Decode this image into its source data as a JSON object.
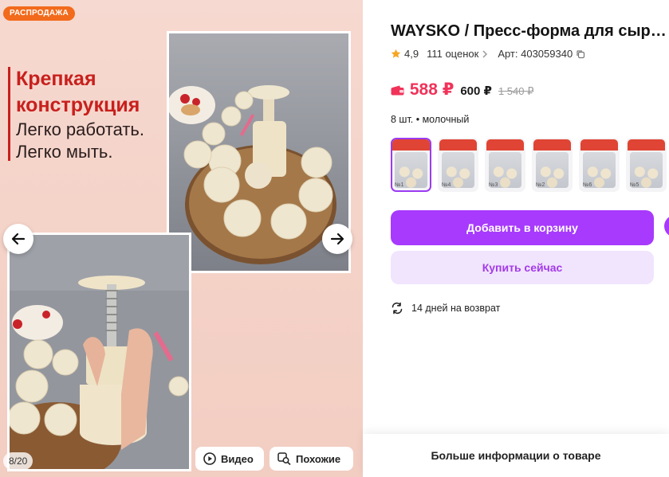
{
  "gallery": {
    "sale_badge": "РАСПРОДАЖА",
    "promo": {
      "headline_line1": "Крепкая",
      "headline_line2": "конструкция",
      "line3": "Легко работать.",
      "line4": "Легко мыть."
    },
    "counter": "8/20",
    "video_label": "Видео",
    "similar_label": "Похожие",
    "icons": {
      "prev": "arrow-left-icon",
      "next": "arrow-right-icon",
      "video": "play-circle-icon",
      "similar": "search-similar-icon"
    },
    "accent_color": "#c8201d"
  },
  "product": {
    "title": "WAYSKO / Пресс-форма для сырников",
    "rating": "4,9",
    "reviews": "111 оценок",
    "article": "Арт: 403059340",
    "price_current": "588 ₽",
    "price_card": "600 ₽",
    "price_old": "1 540 ₽",
    "variant": "8 шт. • молочный",
    "thumbnails": [
      {
        "tag": "№1",
        "active": true
      },
      {
        "tag": "№4",
        "active": false
      },
      {
        "tag": "№3",
        "active": false
      },
      {
        "tag": "№2",
        "active": false
      },
      {
        "tag": "№6",
        "active": false
      },
      {
        "tag": "№5",
        "active": false
      }
    ],
    "add_to_cart": "Добавить в корзину",
    "buy_now": "Купить сейчас",
    "returns": "14 дней на возврат",
    "more_info": "Больше информации о товаре",
    "colors": {
      "primary": "#a73afd",
      "secondary_bg": "#f1e4fd",
      "price": "#f1335a",
      "star": "#f5a623"
    }
  }
}
